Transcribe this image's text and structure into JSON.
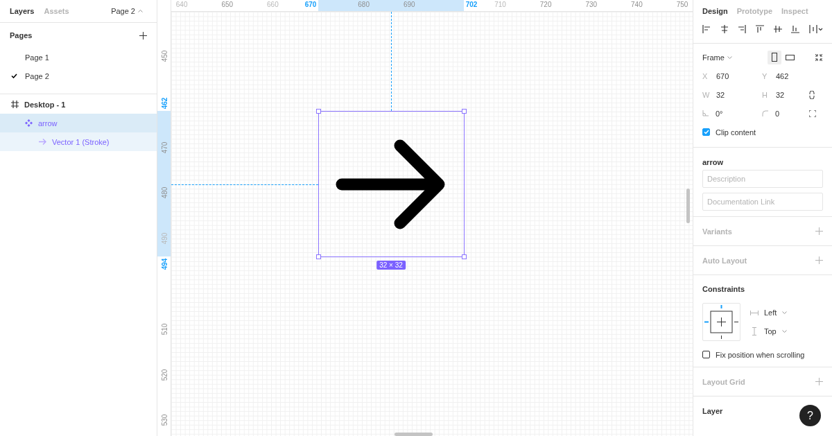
{
  "left_panel": {
    "tabs": [
      {
        "label": "Layers",
        "selected": true
      },
      {
        "label": "Assets",
        "selected": false
      }
    ],
    "page_switcher": "Page 2",
    "pages": {
      "title": "Pages",
      "items": [
        {
          "label": "Page 1",
          "selected": false
        },
        {
          "label": "Page 2",
          "selected": true
        }
      ]
    },
    "layers": [
      {
        "name": "Desktop - 1",
        "kind": "frame",
        "selected": false,
        "children": [
          {
            "name": "arrow",
            "kind": "component",
            "selected": true,
            "children": [
              {
                "name": "Vector 1 (Stroke)",
                "kind": "vector",
                "selected": false
              }
            ]
          }
        ]
      }
    ]
  },
  "rulers": {
    "top": [
      {
        "label": "640",
        "kind": "faded"
      },
      {
        "label": "650",
        "kind": "plain"
      },
      {
        "label": "660",
        "kind": "faded"
      },
      {
        "label": "670",
        "kind": "bound"
      },
      {
        "label": "680",
        "kind": "plain"
      },
      {
        "label": "690",
        "kind": "plain"
      },
      {
        "label": "702",
        "kind": "bound"
      },
      {
        "label": "710",
        "kind": "faded"
      },
      {
        "label": "720",
        "kind": "plain"
      },
      {
        "label": "730",
        "kind": "plain"
      },
      {
        "label": "740",
        "kind": "plain"
      },
      {
        "label": "750",
        "kind": "plain"
      }
    ],
    "left": [
      {
        "label": "450",
        "kind": "plain"
      },
      {
        "label": "462",
        "kind": "bound"
      },
      {
        "label": "470",
        "kind": "plain"
      },
      {
        "label": "480",
        "kind": "plain"
      },
      {
        "label": "490",
        "kind": "faded"
      },
      {
        "label": "494",
        "kind": "bound"
      },
      {
        "label": "510",
        "kind": "plain"
      },
      {
        "label": "520",
        "kind": "plain"
      },
      {
        "label": "530",
        "kind": "plain"
      }
    ]
  },
  "canvas": {
    "selection": {
      "size_label": "32 × 32"
    }
  },
  "right_panel": {
    "tabs": [
      {
        "label": "Design",
        "selected": true
      },
      {
        "label": "Prototype",
        "selected": false
      },
      {
        "label": "Inspect",
        "selected": false
      }
    ],
    "frame": {
      "preset": "Frame",
      "orientations": [
        {
          "kind": "portrait",
          "selected": true
        },
        {
          "kind": "landscape",
          "selected": false
        }
      ],
      "fields": [
        {
          "kind": "text",
          "label": "X",
          "value": "670"
        },
        {
          "kind": "text",
          "label": "Y",
          "value": "462"
        },
        {
          "kind": "text",
          "label": "W",
          "value": "32"
        },
        {
          "kind": "text",
          "label": "H",
          "value": "32"
        },
        {
          "kind": "angle",
          "value": "0°"
        },
        {
          "kind": "radius",
          "value": "0"
        }
      ],
      "clip_content": {
        "label": "Clip content",
        "checked": true
      }
    },
    "component": {
      "name": "arrow",
      "description_placeholder": "Description",
      "link_placeholder": "Documentation Link"
    },
    "variants": "Variants",
    "auto_layout": "Auto Layout",
    "constraints": {
      "title": "Constraints",
      "horizontal": "Left",
      "vertical": "Top",
      "fix_position": {
        "label": "Fix position when scrolling",
        "checked": false
      }
    },
    "layout_grid": "Layout Grid",
    "layer": "Layer"
  },
  "help_button": "?"
}
